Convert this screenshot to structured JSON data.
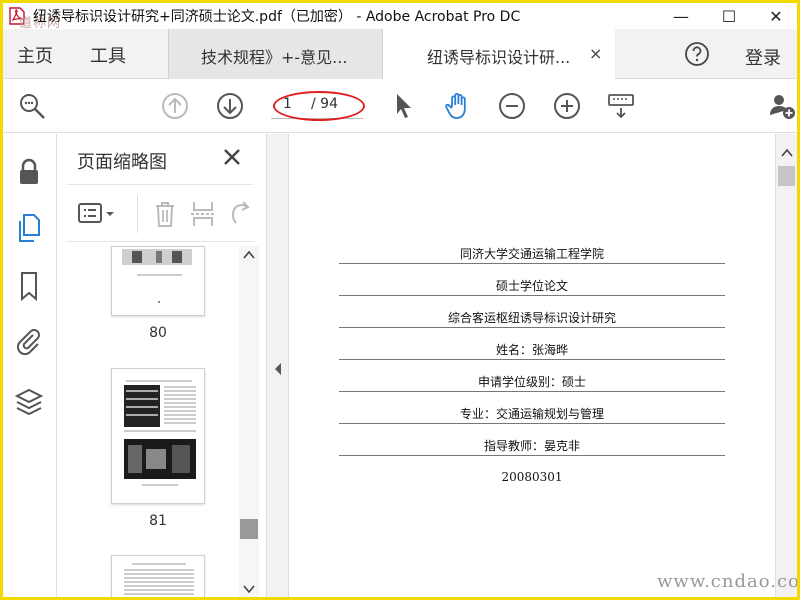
{
  "window": {
    "title": "纽诱导标识设计研究+同济硕士论文.pdf（已加密） - Adobe Acrobat Pro DC",
    "watermark_top": "道称网",
    "minimize_glyph": "—",
    "maximize_glyph": "☐",
    "close_glyph": "✕",
    "frame_color": "#f2d900"
  },
  "tabbar": {
    "home_label": "主页",
    "tools_label": "工具",
    "tabs": [
      {
        "label": "技术规程》+-意见...",
        "active": false
      },
      {
        "label": "纽诱导标识设计研...",
        "active": true,
        "close": "×"
      }
    ],
    "help_icon": "question-circle-icon",
    "login_label": "登录"
  },
  "toolbar": {
    "page_current": "1",
    "page_total": "/ 94",
    "accent_color": "#2a7fd6",
    "icons": [
      "search-zoom-icon",
      "page-up-icon",
      "page-down-icon",
      "select-arrow-icon",
      "hand-tool-icon",
      "zoom-out-icon",
      "zoom-in-icon",
      "keyboard-icon",
      "add-user-icon"
    ],
    "annotation_color": "#e02020"
  },
  "rail": {
    "icons": [
      "lock-icon",
      "page-thumbnails-icon",
      "bookmark-icon",
      "attachment-icon",
      "layers-icon"
    ]
  },
  "thumbnails": {
    "title": "页面缩略图",
    "pages": [
      {
        "number": "80"
      },
      {
        "number": "81"
      }
    ]
  },
  "document": {
    "lines": [
      "同济大学交通运输工程学院",
      "硕士学位论文",
      "综合客运枢纽诱导标识设计研究",
      "姓名：张海晔",
      "申请学位级别：硕士",
      "专业：交通运输规划与管理",
      "指导教师：晏克非",
      "20080301"
    ]
  },
  "watermark": "www.cndao.com"
}
